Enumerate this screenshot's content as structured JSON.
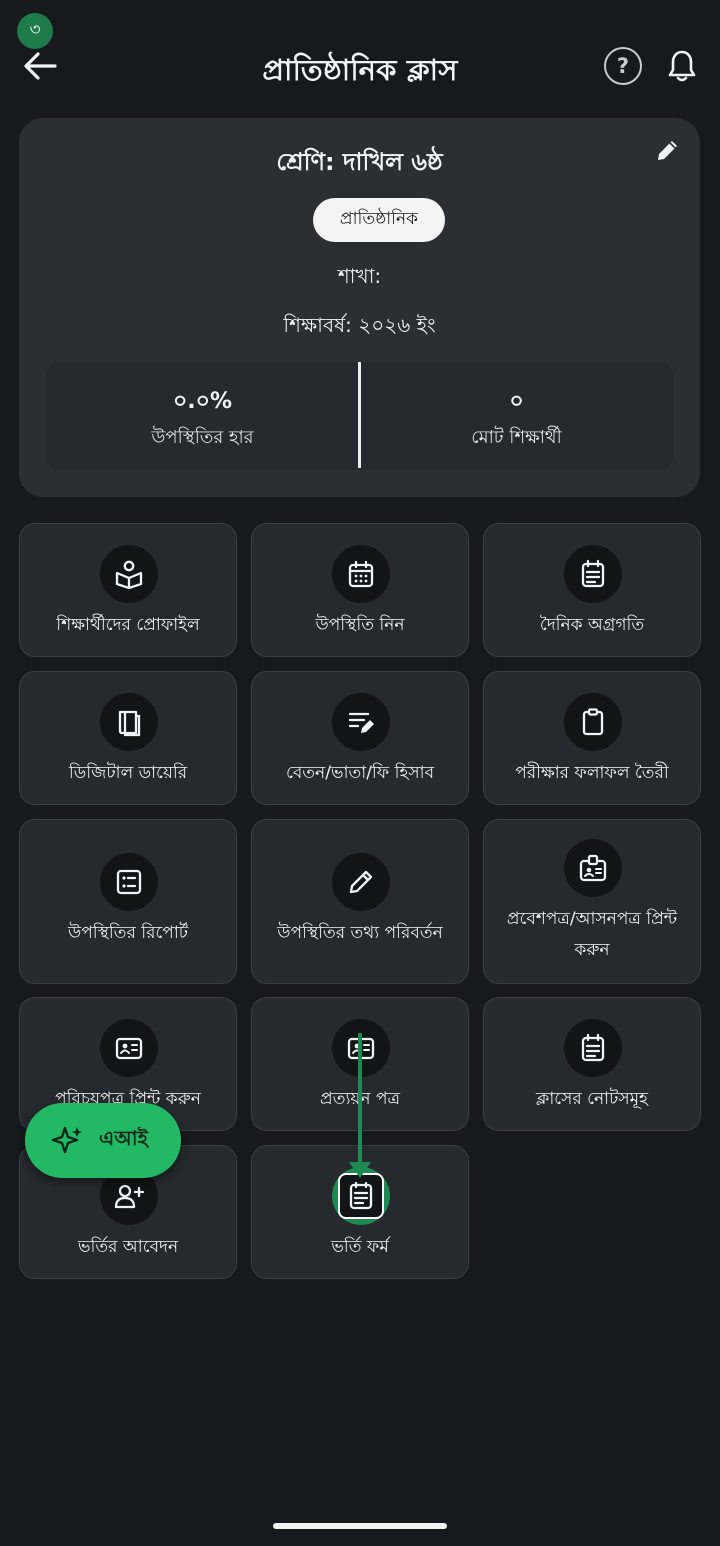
{
  "step_badge": "৩",
  "header": {
    "title": "প্রাতিষ্ঠানিক ক্লাস",
    "help_icon_text": "?"
  },
  "class_card": {
    "class_name": "শ্রেণি: দাখিল ৬ষ্ঠ",
    "type_badge": "প্রাতিষ্ঠানিক",
    "branch": "শাখা:",
    "session": "শিক্ষাবর্ষ: ২০২৬ ইং",
    "stats": {
      "attendance_value": "০.০%",
      "attendance_label": "উপস্থিতির হার",
      "students_value": "০",
      "students_label": "মোট শিক্ষার্থী"
    }
  },
  "features": {
    "items": [
      {
        "label": "শিক্ষার্থীদের প্রোফাইল",
        "icon": "profile-book-icon"
      },
      {
        "label": "উপস্থিতি নিন",
        "icon": "calendar-icon"
      },
      {
        "label": "দৈনিক অগ্রগতি",
        "icon": "notepad-icon"
      },
      {
        "label": "ডিজিটাল ডায়েরি",
        "icon": "diary-icon"
      },
      {
        "label": "বেতন/ভাতা/ফি হিসাব",
        "icon": "edit-note-icon"
      },
      {
        "label": "পরীক্ষার ফলাফল তৈরী",
        "icon": "clipboard-icon"
      },
      {
        "label": "উপস্থিতির রিপোর্ট",
        "icon": "report-list-icon"
      },
      {
        "label": "উপস্থিতির তথ্য পরিবর্তন",
        "icon": "pencil-icon"
      },
      {
        "label": "প্রবেশপত্র/আসনপত্র প্রিন্ট করুন",
        "icon": "badge-icon"
      },
      {
        "label": "পরিচয়পত্র প্রিন্ট করুন",
        "icon": "id-card-icon"
      },
      {
        "label": "প্রত্যয়ন পত্র",
        "icon": "id-card-icon"
      },
      {
        "label": "ক্লাসের নোটসমূহ",
        "icon": "notepad-icon"
      },
      {
        "label": "ভর্তির আবেদন",
        "icon": "add-user-icon"
      },
      {
        "label": "ভর্তি ফর্ম",
        "icon": "form-icon"
      }
    ]
  },
  "ai_button": {
    "label": "এআই",
    "icon": "sparkle-icon"
  },
  "colors": {
    "background": "#17191c",
    "card": "#2b2e33",
    "tile": "#26292e",
    "accent_green": "#22b864",
    "highlight_green": "#1e8a52"
  }
}
